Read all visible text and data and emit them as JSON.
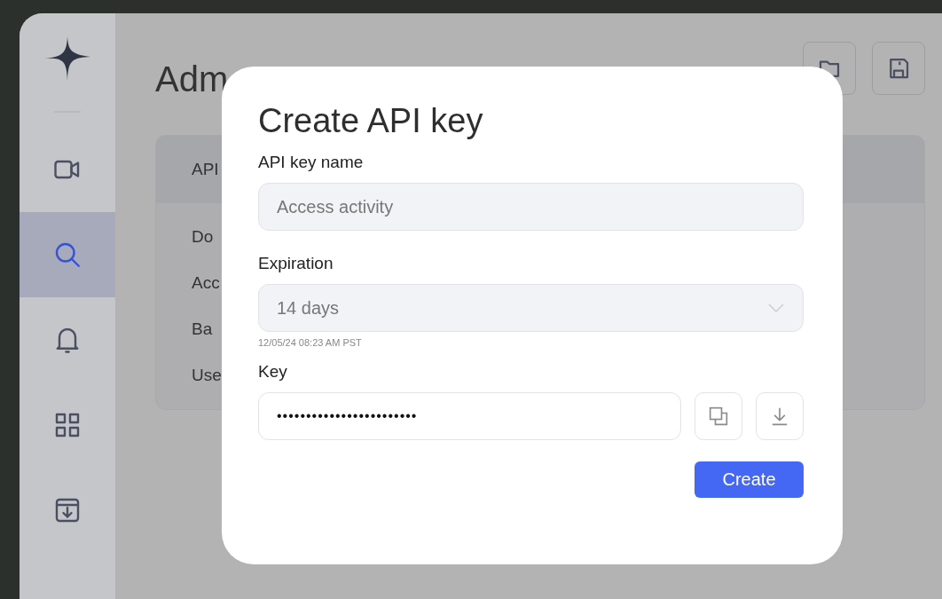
{
  "sidebar": {
    "items": [
      {
        "kind": "video",
        "selected": false
      },
      {
        "kind": "search",
        "selected": true
      },
      {
        "kind": "bell",
        "selected": false
      },
      {
        "kind": "grid",
        "selected": false
      },
      {
        "kind": "archive",
        "selected": false
      }
    ]
  },
  "page": {
    "title": "Adm",
    "toolbar": [
      {
        "kind": "folder"
      },
      {
        "kind": "save"
      }
    ]
  },
  "card": {
    "header": "API",
    "rows": [
      "Do",
      "Acc",
      "Ba",
      "Use"
    ]
  },
  "dialog": {
    "title": "Create API key",
    "name_field": {
      "label": "API key name",
      "placeholder": "Access activity"
    },
    "expiration": {
      "label": "Expiration",
      "value": "14 days",
      "hint": "12/05/24 08:23 AM PST"
    },
    "key": {
      "label": "Key",
      "value": "••••••••••••••••••••••••"
    },
    "key_actions": [
      {
        "kind": "copy"
      },
      {
        "kind": "download"
      }
    ],
    "create_button": "Create"
  }
}
